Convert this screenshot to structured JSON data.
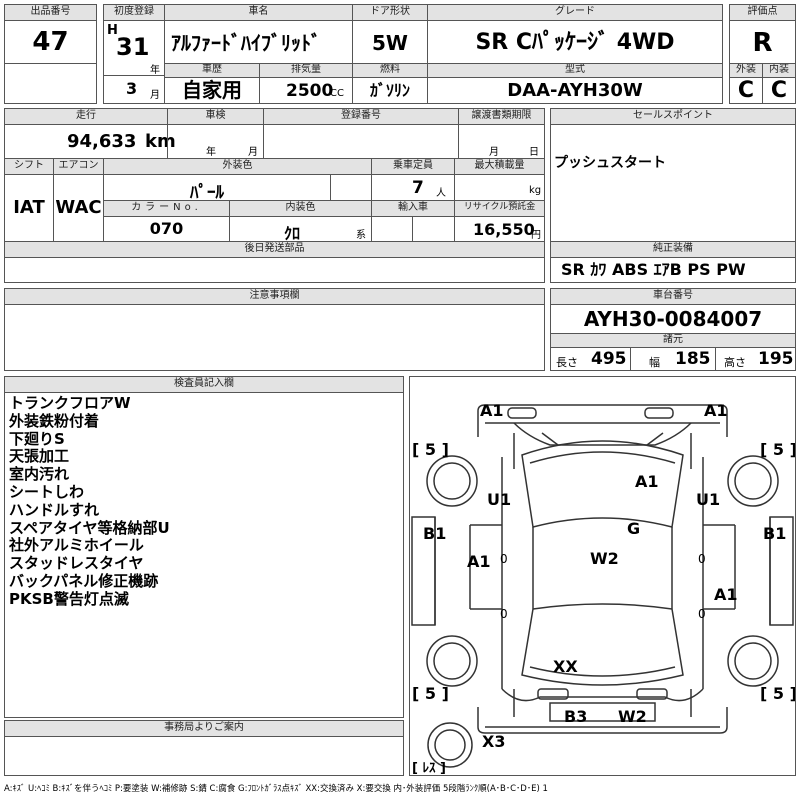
{
  "lot": {
    "label": "出品番号",
    "value": "47"
  },
  "first_reg": {
    "label": "初度登録",
    "era": "H",
    "year": "31",
    "year_unit": "年",
    "month": "3",
    "month_unit": "月"
  },
  "model_name": {
    "label": "車名",
    "value": "ｱﾙﾌｧｰﾄﾞﾊｲﾌﾞﾘｯﾄﾞ"
  },
  "doors": {
    "label": "ドア形状",
    "value": "5W"
  },
  "grade": {
    "label": "グレード",
    "value": "SR Cﾊﾟｯｹｰｼﾞ 4WD"
  },
  "rating": {
    "label": "評価点",
    "value": "R"
  },
  "history": {
    "label": "車歴",
    "value": "自家用"
  },
  "displacement": {
    "label": "排気量",
    "value": "2500",
    "unit": "CC"
  },
  "fuel": {
    "label": "燃料",
    "value": "ｶﾞｿﾘﾝ"
  },
  "model_code": {
    "label": "型式",
    "value": "DAA-AYH30W"
  },
  "exterior_grade": {
    "label": "外装",
    "value": "C"
  },
  "interior_grade": {
    "label": "内装",
    "value": "C"
  },
  "mileage": {
    "label": "走行",
    "value": "94,633",
    "unit": "km"
  },
  "inspection": {
    "label": "車検",
    "year_unit": "年",
    "month_unit": "月"
  },
  "reg_number": {
    "label": "登録番号",
    "value": ""
  },
  "transfer_deadline": {
    "label": "譲渡書類期限",
    "month_unit": "月",
    "day_unit": "日"
  },
  "sales_point": {
    "label": "セールスポイント",
    "value": "プッシュスタート"
  },
  "shift": {
    "label": "シフト",
    "value": "IAT"
  },
  "aircon": {
    "label": "エアコン",
    "value": "WAC"
  },
  "ext_color": {
    "label": "外装色",
    "value": "ﾊﾟｰﾙ"
  },
  "capacity": {
    "label": "乗車定員",
    "value": "7",
    "unit": "人"
  },
  "max_load": {
    "label": "最大積載量",
    "unit": "kg"
  },
  "color_no": {
    "label": "カラーNo.",
    "value": "070"
  },
  "int_color": {
    "label": "内装色",
    "value": "ｸﾛ",
    "unit": "系"
  },
  "import": {
    "label": "輸入車"
  },
  "recycle": {
    "label": "リサイクル預託金",
    "value": "16,550",
    "unit": "円"
  },
  "later_parts": {
    "label": "後日発送部品"
  },
  "factory_equipment": {
    "label": "純正装備",
    "value": "SR ｶﾜ ABS ｴｱB PS PW"
  },
  "caution": {
    "label": "注意事項欄"
  },
  "chassis": {
    "label": "車台番号",
    "value": "AYH30-0084007"
  },
  "specs": {
    "label": "諸元",
    "length_label": "長さ",
    "length": "495",
    "width_label": "幅",
    "width": "185",
    "height_label": "高さ",
    "height": "195"
  },
  "inspector": {
    "label": "検査員記入欄",
    "notes": [
      "トランクフロアW",
      "外装鉄粉付着",
      "下廻りS",
      "天張加工",
      "室内汚れ",
      "シートしわ",
      "ハンドルすれ",
      "スペアタイヤ等格納部U",
      "社外アルミホイール",
      "スタッドレスタイヤ",
      "バックパネル修正機跡",
      "PKSB警告灯点滅"
    ]
  },
  "office": {
    "label": "事務局よりご案内"
  },
  "diagram": {
    "tread_fl": "[ 5 ]",
    "tread_fr": "[ 5 ]",
    "tread_rl": "[ 5 ]",
    "tread_rr": "[ 5 ]",
    "spare": "[ ﾚｽ ]",
    "front_bumper_l": "A1",
    "front_bumper_r": "A1",
    "fender_fl": "U1",
    "fender_fr": "U1",
    "sill_l": "B1",
    "sill_r": "B1",
    "door_l": "A1",
    "door_r": "A1",
    "roof_front": "A1",
    "glass": "G",
    "roof": "W2",
    "rear_glass": "XX",
    "rear_b3": "B3",
    "rear_w2": "W2",
    "rear_x3": "X3",
    "zero_1": "0",
    "zero_2": "0",
    "zero_3": "0",
    "zero_4": "0"
  },
  "legend": "A:ｷｽﾞ U:ﾍｺﾐ B:ｷｽﾞを伴うﾍｺﾐ P:要塗装 W:補修跡 S:錆 C:腐食 G:ﾌﾛﾝﾄｶﾞﾗｽ点ｷｽﾞ XX:交換済み X:要交換 内･外装評価 5段階ﾗﾝｸ順(A･B･C･D･E) 1"
}
